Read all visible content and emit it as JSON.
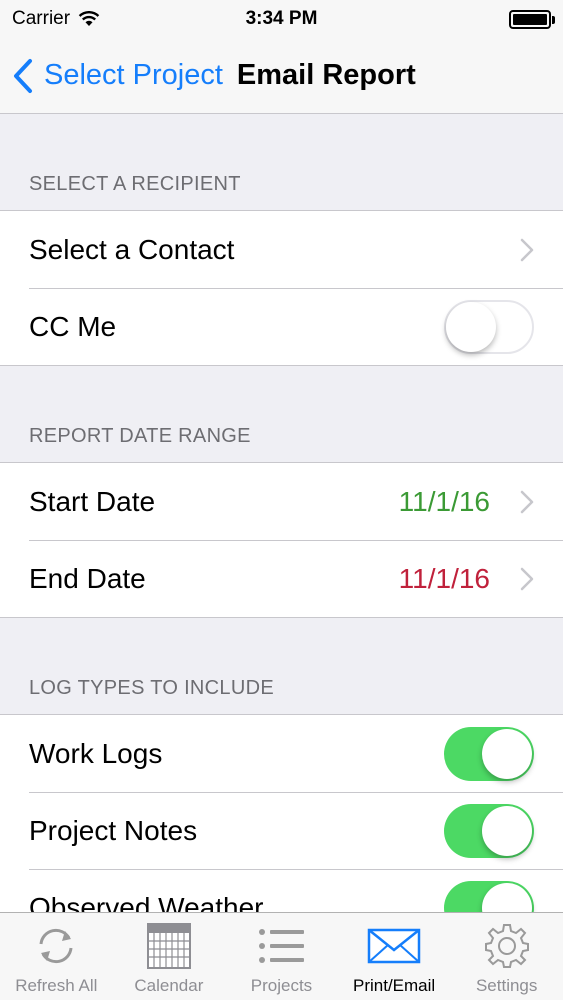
{
  "status_bar": {
    "carrier": "Carrier",
    "time": "3:34 PM"
  },
  "nav": {
    "back_label": "Select Project",
    "title": "Email Report"
  },
  "sections": {
    "recipient": {
      "header": "SELECT A RECIPIENT",
      "select_contact": "Select a Contact",
      "cc_me": "CC Me",
      "cc_me_on": false
    },
    "date_range": {
      "header": "REPORT DATE RANGE",
      "start_label": "Start Date",
      "start_value": "11/1/16",
      "end_label": "End Date",
      "end_value": "11/1/16"
    },
    "log_types": {
      "header": "LOG TYPES TO INCLUDE",
      "items": [
        {
          "label": "Work Logs",
          "on": true
        },
        {
          "label": "Project Notes",
          "on": true
        },
        {
          "label": "Observed Weather",
          "on": true
        }
      ]
    }
  },
  "tab_bar": {
    "tabs": [
      {
        "label": "Refresh All",
        "icon": "refresh-icon"
      },
      {
        "label": "Calendar",
        "icon": "calendar-icon"
      },
      {
        "label": "Projects",
        "icon": "list-icon"
      },
      {
        "label": "Print/Email",
        "icon": "envelope-icon",
        "active": true
      },
      {
        "label": "Settings",
        "icon": "gear-icon"
      }
    ]
  },
  "colors": {
    "accent": "#157efb",
    "toggle_on": "#4cd964",
    "start_date": "#3b9a35",
    "end_date": "#c0213b"
  }
}
